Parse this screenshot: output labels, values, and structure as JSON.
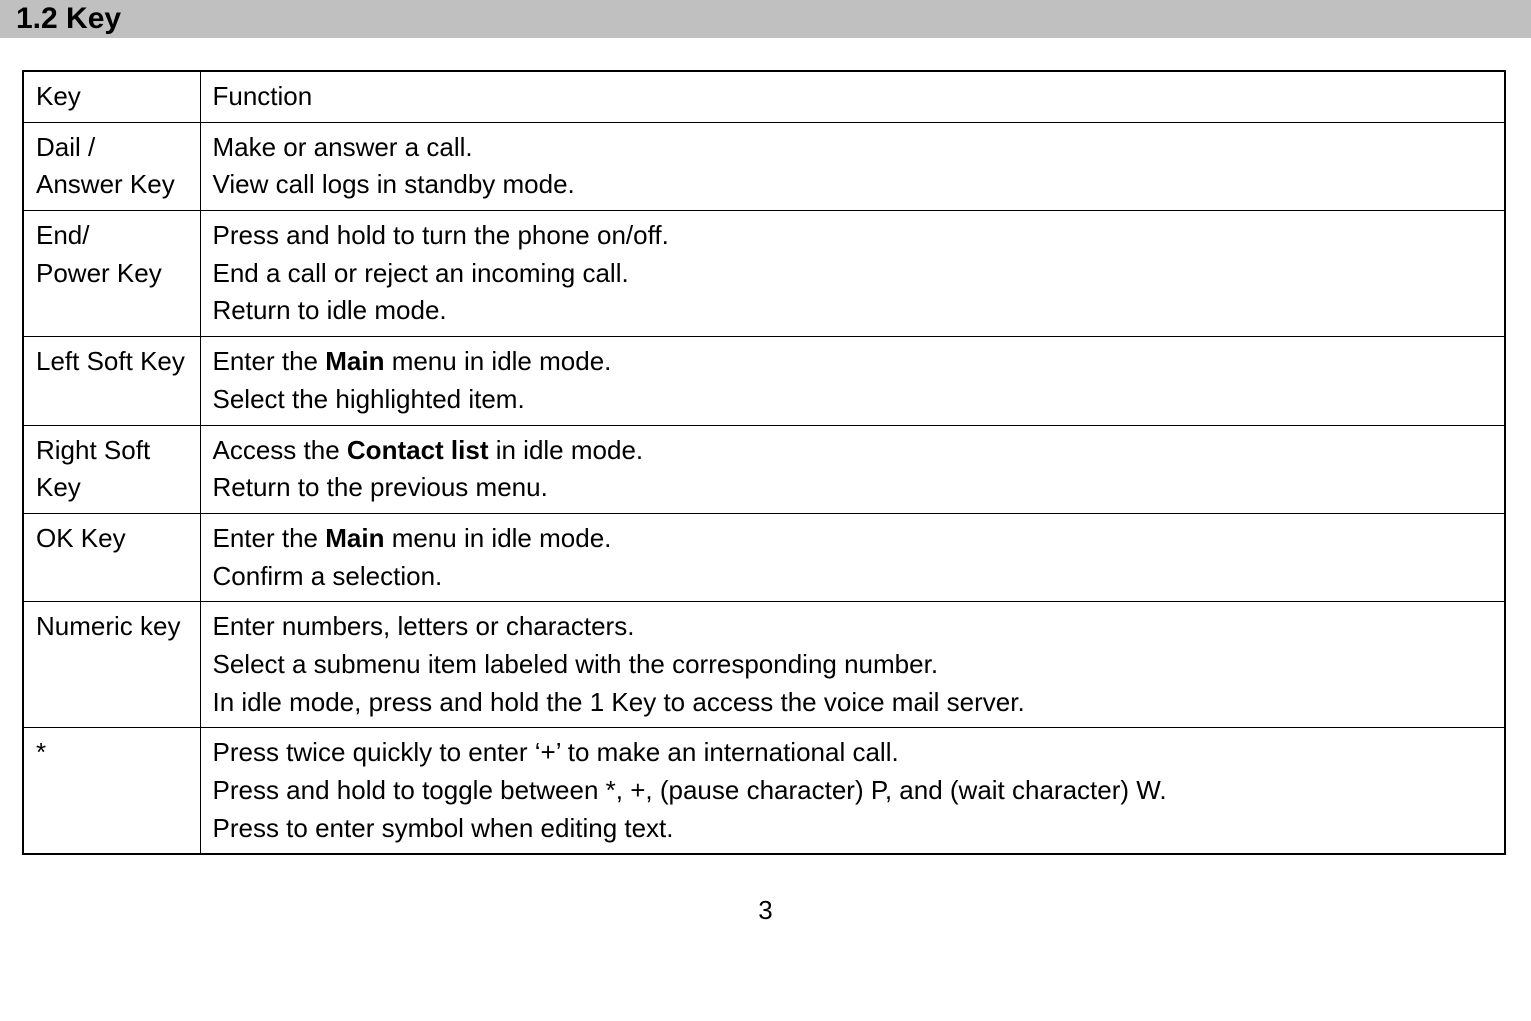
{
  "heading": "1.2 Key",
  "page_number": "3",
  "table": {
    "header": {
      "key": "Key",
      "func": "Function"
    },
    "rows": [
      {
        "key_lines": [
          "Dail /",
          "Answer Key"
        ],
        "func_lines": [
          {
            "pre": "Make or answer a call."
          },
          {
            "pre": "View call logs in standby mode."
          }
        ]
      },
      {
        "key_lines": [
          "End/",
          "Power Key"
        ],
        "func_lines": [
          {
            "pre": "Press and hold to turn the phone on/off."
          },
          {
            "pre": "End a call or reject an incoming call."
          },
          {
            "pre": "Return to idle mode."
          }
        ]
      },
      {
        "key_lines": [
          "Left Soft Key"
        ],
        "func_lines": [
          {
            "pre": "Enter the ",
            "bold": "Main",
            "post": " menu in idle mode."
          },
          {
            "pre": "Select the highlighted item."
          }
        ]
      },
      {
        "key_lines": [
          "Right Soft",
          "Key"
        ],
        "func_lines": [
          {
            "pre": "Access the ",
            "bold": "Contact list",
            "post": " in idle mode."
          },
          {
            "pre": "Return to the previous menu."
          }
        ]
      },
      {
        "key_lines": [
          "OK Key"
        ],
        "func_lines": [
          {
            "pre": "Enter the ",
            "bold": "Main",
            "post": " menu in idle mode."
          },
          {
            "pre": "Confirm a selection."
          }
        ]
      },
      {
        "key_lines": [
          "Numeric key"
        ],
        "func_lines": [
          {
            "pre": "Enter numbers, letters or characters."
          },
          {
            "pre": "Select a submenu item labeled with the corresponding number."
          },
          {
            "pre": "In idle mode, press and hold the 1 Key to access the voice mail server."
          }
        ]
      },
      {
        "key_lines": [
          "*"
        ],
        "func_lines": [
          {
            "pre": "Press twice quickly to enter ‘+’ to make an international call."
          },
          {
            "pre": "Press and hold to toggle between *, +, (pause character) P, and (wait character) W."
          },
          {
            "pre": "Press to enter symbol when editing text."
          }
        ]
      }
    ]
  }
}
